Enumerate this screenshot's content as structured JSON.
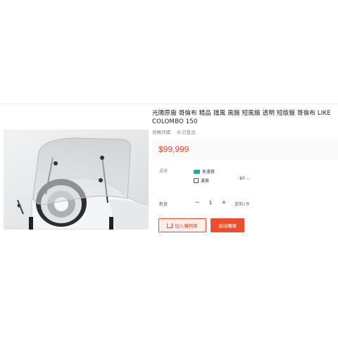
{
  "product": {
    "title": "光陽原廠 哥倫布 精品 擋風 風鏡 短風鏡 透明 短版鏡 哥倫布 LIKE COLOMBO 150",
    "stats": [
      {
        "label": "尚無評價",
        "value": ""
      },
      {
        "label": "已售出",
        "value": "0"
      }
    ],
    "price": "$99,999"
  },
  "shipping": {
    "label": "運費",
    "lines": [
      "免運費",
      "運費"
    ],
    "fee": "$0",
    "fee_icon": "chevron-down-icon"
  },
  "quantity": {
    "label": "數量",
    "value": "1",
    "minus": "−",
    "plus": "+",
    "stock": "還剩1件"
  },
  "actions": {
    "add_to_cart": "加入購物車",
    "buy_now": "直接購買"
  },
  "colors": {
    "accent": "#ee4d2d",
    "free_ship": "#26aa99"
  }
}
